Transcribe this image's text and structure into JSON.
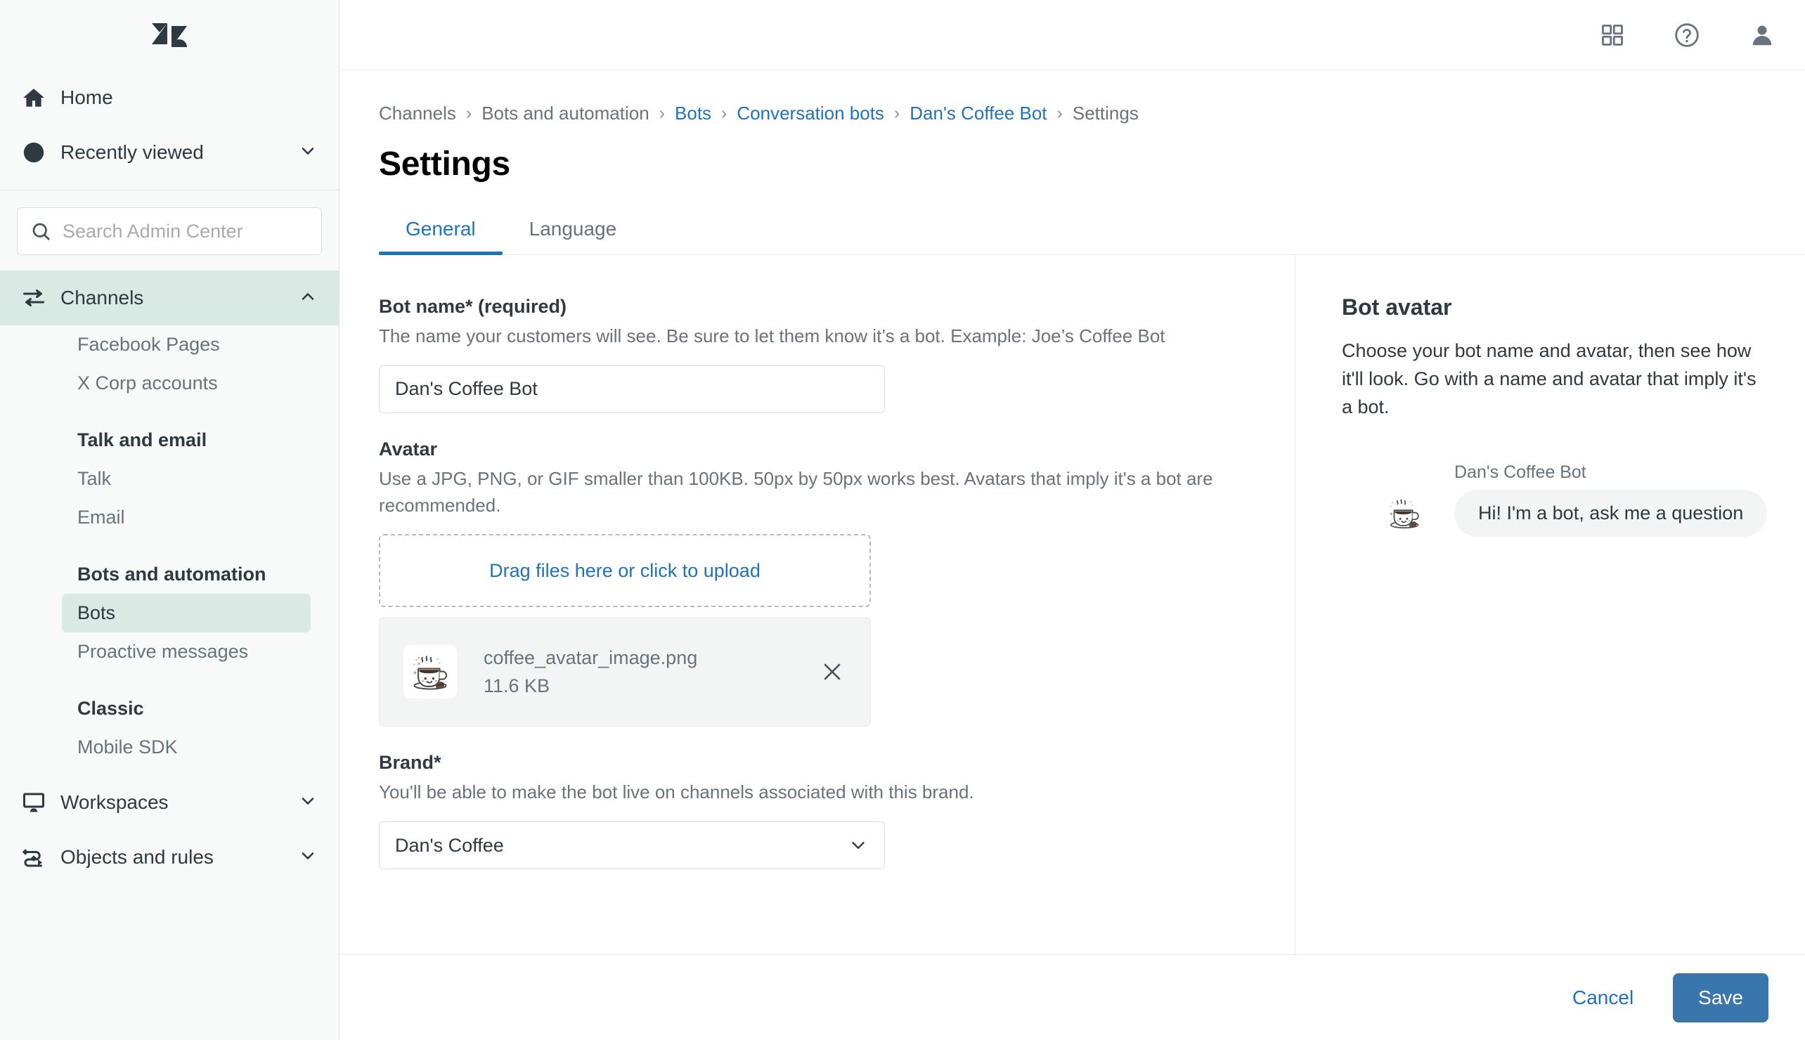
{
  "sidebar": {
    "logo_name": "zendesk-logo",
    "home": {
      "label": "Home",
      "icon": "home-icon"
    },
    "recently_viewed": {
      "label": "Recently viewed",
      "icon": "clock-icon",
      "chevron": "chevron-down-icon"
    },
    "search": {
      "placeholder": "Search Admin Center",
      "value": "",
      "icon": "search-icon"
    },
    "channels": {
      "label": "Channels",
      "icon": "transfer-arrows-icon",
      "chevron": "chevron-up-icon",
      "active": true
    },
    "channel_items": [
      {
        "label": "Facebook Pages"
      },
      {
        "label": "X Corp accounts"
      }
    ],
    "groups": [
      {
        "title": "Talk and email",
        "items": [
          {
            "label": "Talk",
            "selected": false
          },
          {
            "label": "Email",
            "selected": false
          }
        ]
      },
      {
        "title": "Bots and automation",
        "items": [
          {
            "label": "Bots",
            "selected": true
          },
          {
            "label": "Proactive messages",
            "selected": false
          }
        ]
      },
      {
        "title": "Classic",
        "items": [
          {
            "label": "Mobile SDK",
            "selected": false
          }
        ]
      }
    ],
    "bottom_items": [
      {
        "label": "Workspaces",
        "icon": "monitor-icon",
        "chevron": "chevron-down-icon"
      },
      {
        "label": "Objects and rules",
        "icon": "objects-rules-icon",
        "chevron": "chevron-down-icon"
      }
    ]
  },
  "topbar": {
    "icons": [
      {
        "name": "apps-grid-icon"
      },
      {
        "name": "help-circle-icon"
      },
      {
        "name": "user-profile-icon"
      }
    ]
  },
  "breadcrumb": [
    {
      "label": "Channels",
      "link": false
    },
    {
      "label": "Bots and automation",
      "link": false
    },
    {
      "label": "Bots",
      "link": true
    },
    {
      "label": "Conversation bots",
      "link": true
    },
    {
      "label": "Dan's Coffee Bot",
      "link": true
    },
    {
      "label": "Settings",
      "link": false
    }
  ],
  "page": {
    "title": "Settings"
  },
  "tabs": [
    {
      "label": "General",
      "active": true
    },
    {
      "label": "Language",
      "active": false
    }
  ],
  "form": {
    "bot_name": {
      "label": "Bot name* (required)",
      "help": "The name your customers will see. Be sure to let them know it’s a bot. Example: Joe’s Coffee Bot",
      "value": "Dan's Coffee Bot",
      "placeholder": ""
    },
    "avatar": {
      "label": "Avatar",
      "help": "Use a JPG, PNG, or GIF smaller than 100KB. 50px by 50px works best. Avatars that imply it's a bot are recommended.",
      "dropzone_text": "Drag files here or click to upload",
      "file": {
        "name": "coffee_avatar_image.png",
        "size": "11.6 KB",
        "thumb_icon": "coffee-cup-icon",
        "remove_icon": "close-icon"
      }
    },
    "brand": {
      "label": "Brand*",
      "help": "You'll be able to make the bot live on channels associated with this brand.",
      "value": "Dan's Coffee",
      "chevron": "chevron-down-icon"
    }
  },
  "side_panel": {
    "title": "Bot avatar",
    "description": "Choose your bot name and avatar, then see how it'll look. Go with a name and avatar that imply it's a bot.",
    "preview": {
      "bot_name": "Dan's Coffee Bot",
      "message": "Hi! I'm a bot, ask me a question",
      "avatar_icon": "coffee-cup-icon"
    }
  },
  "footer": {
    "cancel_label": "Cancel",
    "save_label": "Save"
  },
  "colors": {
    "accent_blue": "#1f73b7",
    "save_button": "#3a76ab",
    "sidebar_bg": "#f8f9f9",
    "selected_nav": "#d8eae3",
    "text_primary": "#2f3941",
    "text_secondary": "#68737d"
  }
}
